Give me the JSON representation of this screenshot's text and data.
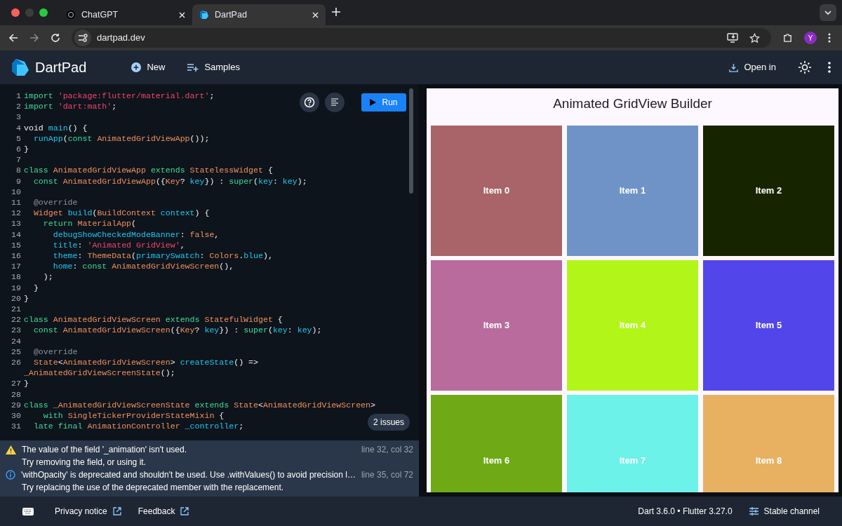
{
  "browser": {
    "tabs": [
      {
        "label": "ChatGPT",
        "selected": false
      },
      {
        "label": "DartPad",
        "selected": true
      }
    ],
    "address": "dartpad.dev",
    "avatar": "Y"
  },
  "header": {
    "app_name": "DartPad",
    "actions": [
      "New",
      "Samples"
    ],
    "open_in": "Open in"
  },
  "editor": {
    "run": "Run",
    "issues_badge": "2 issues",
    "lines": [
      {
        "number": "1",
        "tokens": [
          {
            "kind": "kw",
            "text": "import "
          },
          {
            "kind": "str",
            "text": "'package:flutter/material.dart'"
          },
          {
            "kind": "plain",
            "text": ";"
          }
        ]
      },
      {
        "number": "2",
        "tokens": [
          {
            "kind": "kw",
            "text": "import "
          },
          {
            "kind": "str",
            "text": "'dart:math'"
          },
          {
            "kind": "plain",
            "text": ";"
          }
        ]
      },
      {
        "number": "3"
      },
      {
        "number": "4",
        "tokens": [
          {
            "kind": "plain",
            "text": "void "
          },
          {
            "kind": "id",
            "text": "main"
          },
          {
            "kind": "plain",
            "text": "() {"
          }
        ]
      },
      {
        "number": "5",
        "tokens": [
          {
            "kind": "id",
            "text": "  runApp"
          },
          {
            "kind": "plain",
            "text": "("
          },
          {
            "kind": "kw",
            "text": "const "
          },
          {
            "kind": "type",
            "text": "AnimatedGridViewApp"
          },
          {
            "kind": "plain",
            "text": "());"
          }
        ]
      },
      {
        "number": "6",
        "tokens": [
          {
            "kind": "plain",
            "text": "}"
          }
        ]
      },
      {
        "number": "7"
      },
      {
        "number": "8",
        "tokens": [
          {
            "kind": "kw",
            "text": "class "
          },
          {
            "kind": "type",
            "text": "AnimatedGridViewApp "
          },
          {
            "kind": "kw",
            "text": "extends "
          },
          {
            "kind": "type",
            "text": "StatelessWidget"
          },
          {
            "kind": "plain",
            "text": " {"
          }
        ]
      },
      {
        "number": "9",
        "tokens": [
          {
            "kind": "kw",
            "text": "  const "
          },
          {
            "kind": "type",
            "text": "AnimatedGridViewApp"
          },
          {
            "kind": "plain",
            "text": "({"
          },
          {
            "kind": "type",
            "text": "Key"
          },
          {
            "kind": "plain",
            "text": "? "
          },
          {
            "kind": "id",
            "text": "key"
          },
          {
            "kind": "plain",
            "text": "}) : "
          },
          {
            "kind": "kw",
            "text": "super"
          },
          {
            "kind": "plain",
            "text": "("
          },
          {
            "kind": "id",
            "text": "key"
          },
          {
            "kind": "plain",
            "text": ": "
          },
          {
            "kind": "id",
            "text": "key"
          },
          {
            "kind": "plain",
            "text": ");"
          }
        ]
      },
      {
        "number": "10"
      },
      {
        "number": "11",
        "tokens": [
          {
            "kind": "meta",
            "text": "  @override"
          }
        ]
      },
      {
        "number": "12",
        "tokens": [
          {
            "kind": "type",
            "text": "  Widget "
          },
          {
            "kind": "id",
            "text": "build"
          },
          {
            "kind": "plain",
            "text": "("
          },
          {
            "kind": "type",
            "text": "BuildContext "
          },
          {
            "kind": "id",
            "text": "context"
          },
          {
            "kind": "plain",
            "text": ") {"
          }
        ]
      },
      {
        "number": "13",
        "tokens": [
          {
            "kind": "kw",
            "text": "    return "
          },
          {
            "kind": "type",
            "text": "MaterialApp"
          },
          {
            "kind": "plain",
            "text": "("
          }
        ]
      },
      {
        "number": "14",
        "tokens": [
          {
            "kind": "id",
            "text": "      debugShowCheckedModeBanner"
          },
          {
            "kind": "plain",
            "text": ": "
          },
          {
            "kind": "type",
            "text": "false"
          },
          {
            "kind": "plain",
            "text": ","
          }
        ]
      },
      {
        "number": "15",
        "tokens": [
          {
            "kind": "id",
            "text": "      title"
          },
          {
            "kind": "plain",
            "text": ": "
          },
          {
            "kind": "str",
            "text": "'Animated GridView'"
          },
          {
            "kind": "plain",
            "text": ","
          }
        ]
      },
      {
        "number": "16",
        "tokens": [
          {
            "kind": "id",
            "text": "      theme"
          },
          {
            "kind": "plain",
            "text": ": "
          },
          {
            "kind": "type",
            "text": "ThemeData"
          },
          {
            "kind": "plain",
            "text": "("
          },
          {
            "kind": "id",
            "text": "primarySwatch"
          },
          {
            "kind": "plain",
            "text": ": "
          },
          {
            "kind": "type",
            "text": "Colors"
          },
          {
            "kind": "plain",
            "text": "."
          },
          {
            "kind": "id",
            "text": "blue"
          },
          {
            "kind": "plain",
            "text": "),"
          }
        ]
      },
      {
        "number": "17",
        "tokens": [
          {
            "kind": "id",
            "text": "      home"
          },
          {
            "kind": "plain",
            "text": ": "
          },
          {
            "kind": "kw",
            "text": "const "
          },
          {
            "kind": "type",
            "text": "AnimatedGridViewScreen"
          },
          {
            "kind": "plain",
            "text": "(),"
          }
        ]
      },
      {
        "number": "18",
        "tokens": [
          {
            "kind": "plain",
            "text": "    );"
          }
        ]
      },
      {
        "number": "19",
        "tokens": [
          {
            "kind": "plain",
            "text": "  }"
          }
        ]
      },
      {
        "number": "20",
        "tokens": [
          {
            "kind": "plain",
            "text": "}"
          }
        ]
      },
      {
        "number": "21"
      },
      {
        "number": "22",
        "tokens": [
          {
            "kind": "kw",
            "text": "class "
          },
          {
            "kind": "type",
            "text": "AnimatedGridViewScreen "
          },
          {
            "kind": "kw",
            "text": "extends "
          },
          {
            "kind": "type",
            "text": "StatefulWidget"
          },
          {
            "kind": "plain",
            "text": " {"
          }
        ]
      },
      {
        "number": "23",
        "tokens": [
          {
            "kind": "kw",
            "text": "  const "
          },
          {
            "kind": "type",
            "text": "AnimatedGridViewScreen"
          },
          {
            "kind": "plain",
            "text": "({"
          },
          {
            "kind": "type",
            "text": "Key"
          },
          {
            "kind": "plain",
            "text": "? "
          },
          {
            "kind": "id",
            "text": "key"
          },
          {
            "kind": "plain",
            "text": "}) : "
          },
          {
            "kind": "kw",
            "text": "super"
          },
          {
            "kind": "plain",
            "text": "("
          },
          {
            "kind": "id",
            "text": "key"
          },
          {
            "kind": "plain",
            "text": ": "
          },
          {
            "kind": "id",
            "text": "key"
          },
          {
            "kind": "plain",
            "text": ");"
          }
        ]
      },
      {
        "number": "24"
      },
      {
        "number": "25",
        "tokens": [
          {
            "kind": "meta",
            "text": "  @override"
          }
        ]
      },
      {
        "number": "26",
        "tokens": [
          {
            "kind": "type",
            "text": "  State"
          },
          {
            "kind": "plain",
            "text": "<"
          },
          {
            "kind": "type",
            "text": "AnimatedGridViewScreen"
          },
          {
            "kind": "plain",
            "text": "> "
          },
          {
            "kind": "id",
            "text": "createState"
          },
          {
            "kind": "plain",
            "text": "() =>"
          }
        ]
      },
      {
        "tokens": [
          {
            "kind": "type",
            "text": "_AnimatedGridViewScreenState"
          },
          {
            "kind": "plain",
            "text": "();"
          }
        ]
      },
      {
        "number": "27",
        "tokens": [
          {
            "kind": "plain",
            "text": "}"
          }
        ]
      },
      {
        "number": "28"
      },
      {
        "number": "29",
        "tokens": [
          {
            "kind": "kw",
            "text": "class "
          },
          {
            "kind": "type",
            "text": "_AnimatedGridViewScreenState "
          },
          {
            "kind": "kw",
            "text": "extends "
          },
          {
            "kind": "type",
            "text": "State"
          },
          {
            "kind": "plain",
            "text": "<"
          },
          {
            "kind": "type",
            "text": "AnimatedGridViewScreen"
          },
          {
            "kind": "plain",
            "text": ">"
          }
        ]
      },
      {
        "number": "30",
        "tokens": [
          {
            "kind": "kw",
            "text": "    with "
          },
          {
            "kind": "type",
            "text": "SingleTickerProviderStateMixin"
          },
          {
            "kind": "plain",
            "text": " {"
          }
        ]
      },
      {
        "number": "31",
        "tokens": [
          {
            "kind": "kw",
            "text": "  late final "
          },
          {
            "kind": "type",
            "text": "AnimationController "
          },
          {
            "kind": "id",
            "text": "_controller"
          },
          {
            "kind": "plain",
            "text": ";"
          }
        ]
      }
    ]
  },
  "issues": [
    {
      "kind": "warning",
      "message": "The value of the field '_animation' isn't used.",
      "hint": "Try removing the field, or using it.",
      "location": "line 32, col 32"
    },
    {
      "kind": "info",
      "message": "'withOpacity' is deprecated and shouldn't be used. Use .withValues() to avoid precision l…",
      "hint": "Try replacing the use of the deprecated member with the replacement.",
      "location": "line 35, col 72"
    }
  ],
  "preview": {
    "title": "Animated GridView Builder",
    "tiles": [
      {
        "label": "Item 0",
        "color": "#a86468"
      },
      {
        "label": "Item 1",
        "color": "#6f93c6"
      },
      {
        "label": "Item 2",
        "color": "#172400"
      },
      {
        "label": "Item 3",
        "color": "#b86b9c"
      },
      {
        "label": "Item 4",
        "color": "#b2f519"
      },
      {
        "label": "Item 5",
        "color": "#5245ea"
      },
      {
        "label": "Item 6",
        "color": "#6faa16"
      },
      {
        "label": "Item 7",
        "color": "#6cf2e8"
      },
      {
        "label": "Item 8",
        "color": "#e7b161"
      }
    ]
  },
  "footer": {
    "links": [
      "Privacy notice",
      "Feedback"
    ],
    "version": "Dart 3.6.0 • Flutter 3.27.0",
    "channel": "Stable channel"
  }
}
